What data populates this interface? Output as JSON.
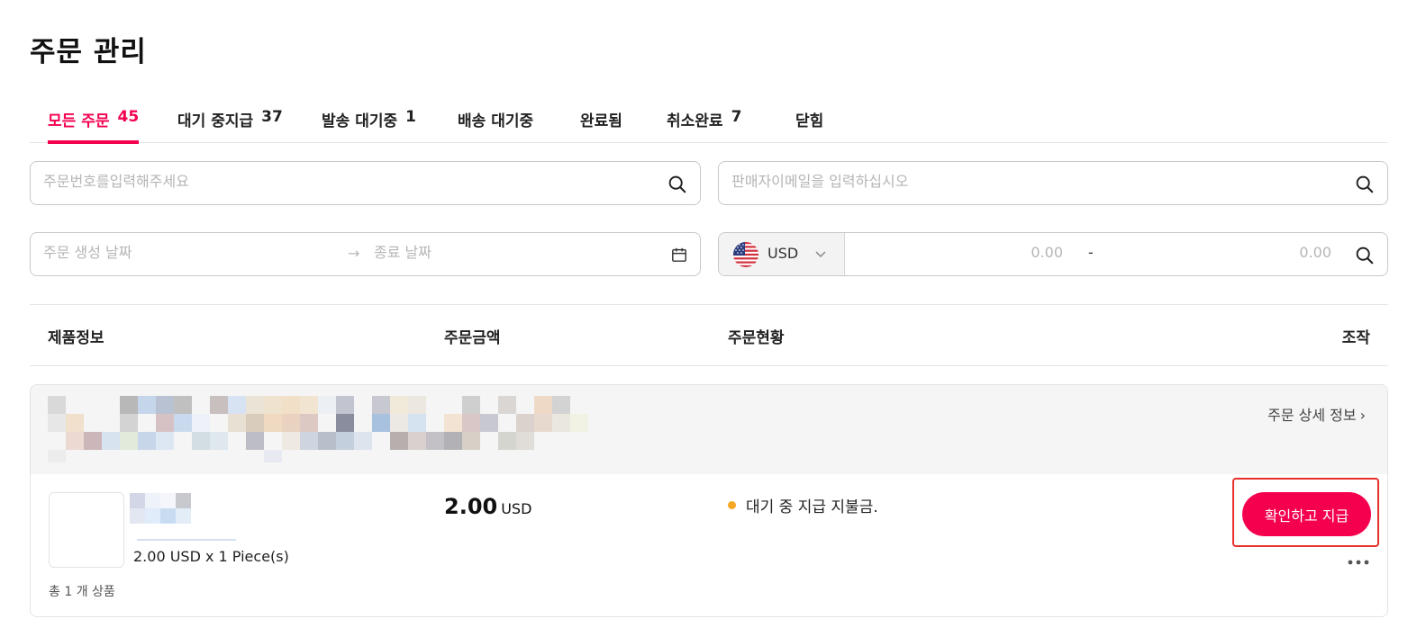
{
  "page": {
    "title": "주문 관리"
  },
  "tabs": [
    {
      "label": "모든 주문",
      "count": "45"
    },
    {
      "label": "대기 중지급",
      "count": "37"
    },
    {
      "label": "발송 대기중",
      "count": "1"
    },
    {
      "label": "배송 대기중",
      "count": ""
    },
    {
      "label": "완료됨",
      "count": ""
    },
    {
      "label": "취소완료",
      "count": "7"
    },
    {
      "label": "닫힘",
      "count": ""
    }
  ],
  "filters": {
    "order_number_placeholder": "주문번호를입력해주세요",
    "seller_email_placeholder": "판매자이메일을 입력하십시오",
    "date_from_placeholder": "주문 생성 날짜",
    "date_arrow": "→",
    "date_to_placeholder": "종료 날짜",
    "currency": "USD",
    "amount_min_placeholder": "0.00",
    "amount_separator": "-",
    "amount_max_placeholder": "0.00"
  },
  "table": {
    "headers": {
      "product_info": "제품정보",
      "order_amount": "주문금액",
      "order_status": "주문현황",
      "actions": "조작"
    }
  },
  "order": {
    "detail_link": "주문 상세 정보",
    "unit_price_line": "2.00 USD x 1 Piece(s)",
    "total_items": "총 1 개 상품",
    "amount": "2.00",
    "amount_currency": "USD",
    "status": "대기 중 지급 지불금.",
    "status_color": "#f5a623",
    "pay_button": "확인하고 지급",
    "more_icon": "more-horizontal-icon"
  },
  "colors": {
    "accent": "#f5004f",
    "highlight_frame": "#e8302b"
  }
}
